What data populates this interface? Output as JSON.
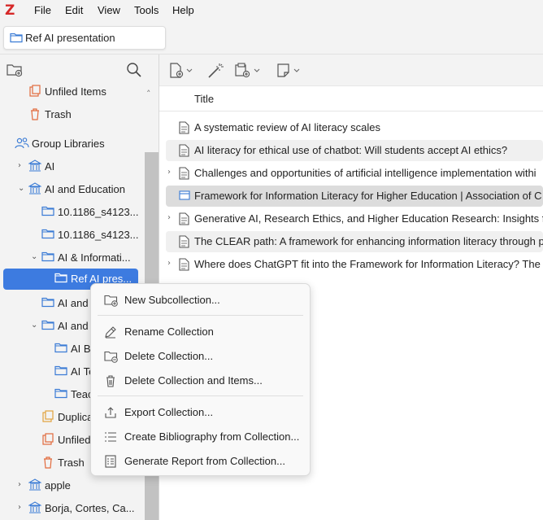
{
  "app": {
    "logo": "Z"
  },
  "menu": {
    "file": "File",
    "edit": "Edit",
    "view": "View",
    "tools": "Tools",
    "help": "Help"
  },
  "tab": {
    "label": "Ref AI presentation"
  },
  "tree": {
    "unfiled_items": "Unfiled Items",
    "trash": "Trash",
    "group_libraries": "Group Libraries",
    "ai": "AI",
    "ai_and_education": "AI and Education",
    "doi_1": "10.1186_s4123...",
    "doi_2": "10.1186_s4123...",
    "ai_information": "AI & Informati...",
    "ref_ai_pres": "Ref AI pres...",
    "ai_and_1": "AI and",
    "ai_and_2": "AI and",
    "ai_b": "AI B",
    "ai_te": "AI Te",
    "teac": "Teac",
    "duplicates": "Duplica",
    "unfiled_2": "Unfiled",
    "trash_2": "Trash",
    "apple": "apple",
    "borja": "Borja, Cortes, Ca..."
  },
  "items": {
    "column_title": "Title",
    "rows": [
      "A systematic review of AI literacy scales",
      "AI literacy for ethical use of chatbot: Will students accept AI ethics?",
      "Challenges and opportunities of artificial intelligence implementation withi",
      "Framework for Information Literacy for Higher Education | Association of C",
      "Generative AI, Research Ethics, and Higher Education Research: Insights fr",
      "The CLEAR path: A framework for enhancing information literacy through p",
      "Where does ChatGPT fit into the Framework for Information Literacy? The"
    ]
  },
  "context_menu": {
    "new_subcollection": "New Subcollection...",
    "rename": "Rename Collection",
    "delete": "Delete Collection...",
    "delete_items": "Delete Collection and Items...",
    "export": "Export Collection...",
    "bibliography": "Create Bibliography from Collection...",
    "report": "Generate Report from Collection..."
  },
  "colors": {
    "accent": "#3d7be0",
    "brand": "#d62828",
    "folder": "#3a7bd5"
  }
}
